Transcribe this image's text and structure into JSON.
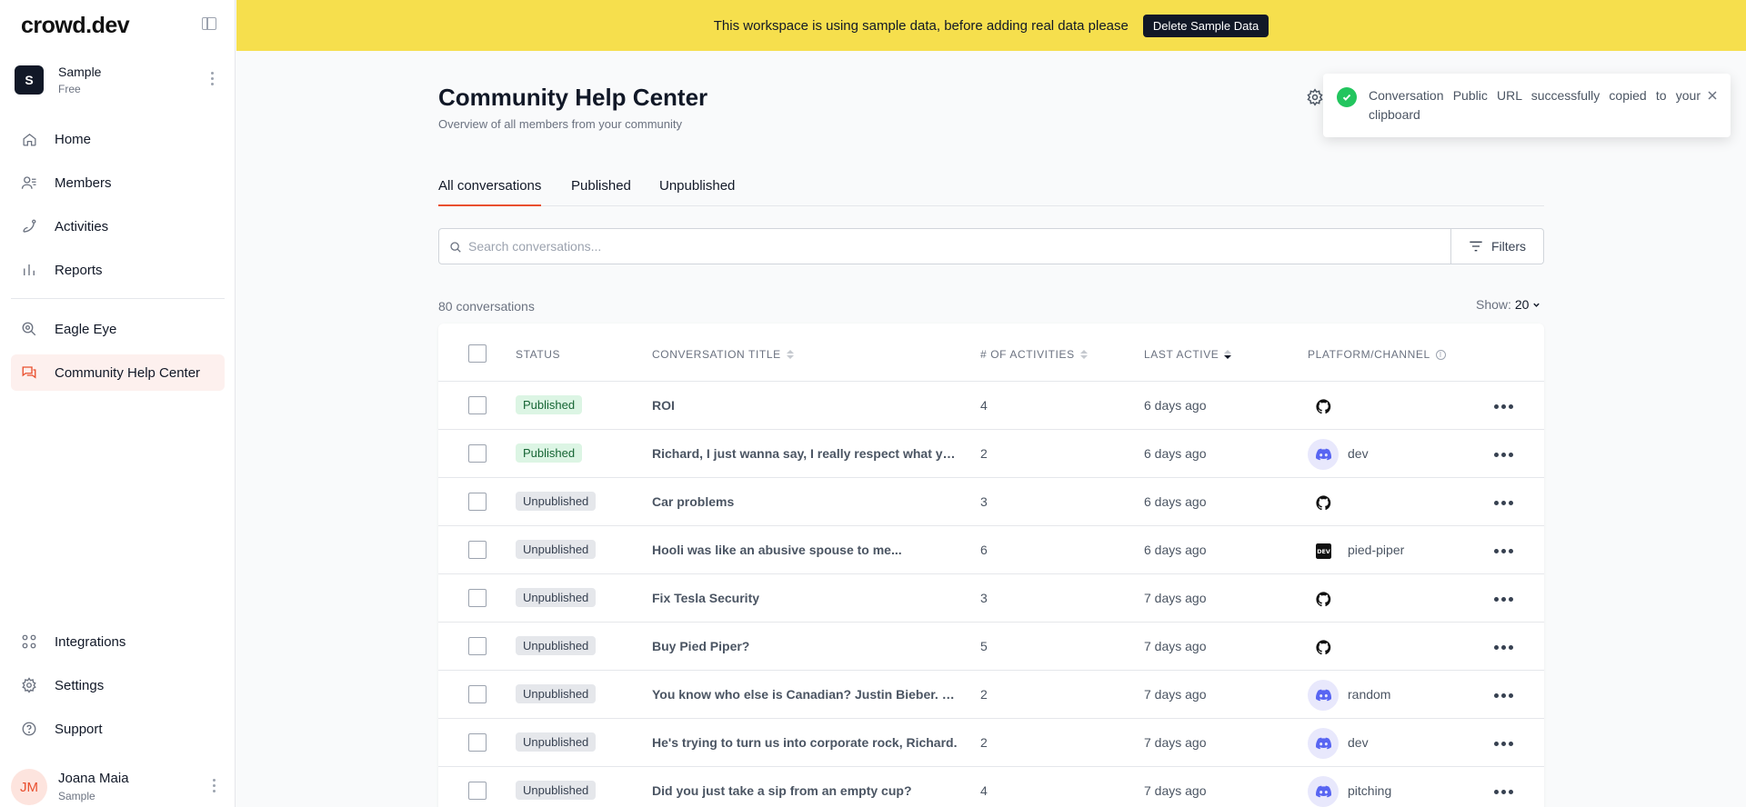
{
  "app": {
    "logo": "crowd.dev"
  },
  "workspace": {
    "initial": "S",
    "name": "Sample",
    "plan": "Free"
  },
  "sidebar": {
    "nav": [
      {
        "label": "Home",
        "icon": "home-icon"
      },
      {
        "label": "Members",
        "icon": "members-icon"
      },
      {
        "label": "Activities",
        "icon": "activities-icon"
      },
      {
        "label": "Reports",
        "icon": "reports-icon"
      },
      {
        "label": "Eagle Eye",
        "icon": "eagle-eye-icon"
      },
      {
        "label": "Community Help Center",
        "icon": "chat-icon",
        "active": true
      }
    ],
    "bottom": [
      {
        "label": "Integrations",
        "icon": "integrations-icon"
      },
      {
        "label": "Settings",
        "icon": "gear-icon"
      },
      {
        "label": "Support",
        "icon": "help-icon"
      }
    ]
  },
  "user": {
    "initials": "JM",
    "name": "Joana Maia",
    "role": "Sample"
  },
  "banner": {
    "text": "This workspace is using sample data, before adding real data please",
    "button": "Delete Sample Data"
  },
  "page": {
    "title": "Community Help Center",
    "subtitle": "Overview of all members from your community"
  },
  "tabs": [
    {
      "label": "All conversations",
      "active": true
    },
    {
      "label": "Published"
    },
    {
      "label": "Unpublished"
    }
  ],
  "search": {
    "placeholder": "Search conversations...",
    "value": ""
  },
  "filters": {
    "label": "Filters"
  },
  "summary": {
    "count": "80 conversations",
    "show_label": "Show:",
    "show_value": "20"
  },
  "table": {
    "headers": {
      "status": "Status",
      "title": "Conversation title",
      "activities": "# of activities",
      "last_active": "Last active",
      "platform": "Platform/Channel"
    },
    "rows": [
      {
        "status": "Published",
        "title": "ROI",
        "activities": "4",
        "last_active": "6 days ago",
        "platform": "github",
        "channel": ""
      },
      {
        "status": "Published",
        "title": "Richard, I just wanna say, I really respect what you're doing",
        "activities": "2",
        "last_active": "6 days ago",
        "platform": "discord",
        "channel": "dev"
      },
      {
        "status": "Unpublished",
        "title": "Car problems",
        "activities": "3",
        "last_active": "6 days ago",
        "platform": "github",
        "channel": ""
      },
      {
        "status": "Unpublished",
        "title": "Hooli was like an abusive spouse to me...",
        "activities": "6",
        "last_active": "6 days ago",
        "platform": "devto",
        "channel": "pied-piper"
      },
      {
        "status": "Unpublished",
        "title": "Fix Tesla Security",
        "activities": "3",
        "last_active": "7 days ago",
        "platform": "github",
        "channel": ""
      },
      {
        "status": "Unpublished",
        "title": "Buy Pied Piper?",
        "activities": "5",
        "last_active": "7 days ago",
        "platform": "github",
        "channel": ""
      },
      {
        "status": "Unpublished",
        "title": "You know who else is Canadian? Justin Bieber. That's who.",
        "activities": "2",
        "last_active": "7 days ago",
        "platform": "discord",
        "channel": "random"
      },
      {
        "status": "Unpublished",
        "title": "He's trying to turn us into corporate rock, Richard.",
        "activities": "2",
        "last_active": "7 days ago",
        "platform": "discord",
        "channel": "dev"
      },
      {
        "status": "Unpublished",
        "title": "Did you just take a sip from an empty cup?",
        "activities": "4",
        "last_active": "7 days ago",
        "platform": "discord",
        "channel": "pitching"
      }
    ]
  },
  "toast": {
    "message": "Conversation Public URL successfully copied to your clipboard"
  },
  "colors": {
    "accent": "#e94f2e",
    "banner": "#f6df4d",
    "published_bg": "#dcf5e4",
    "unpublished_bg": "#e5e7eb",
    "discord": "#5865f2"
  }
}
